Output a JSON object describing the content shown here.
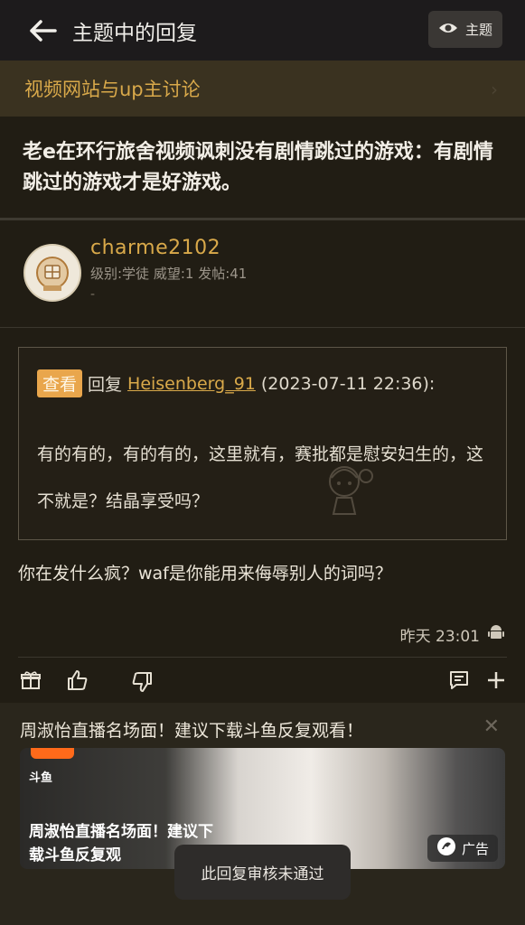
{
  "header": {
    "title": "主题中的回复",
    "topic_button_label": "主题"
  },
  "forum": {
    "name": "视频网站与up主讨论"
  },
  "post": {
    "title": "老e在环行旅舍视频讽刺没有剧情跳过的游戏：有剧情跳过的游戏才是好游戏。"
  },
  "author": {
    "name": "charme2102",
    "meta": "级别:学徒 威望:1 发帖:41",
    "sub": "-"
  },
  "quote": {
    "tag": "查看",
    "prefix": "回复",
    "user": "Heisenberg_91",
    "datetime": "(2023-07-11 22:36):",
    "body": "有的有的，有的有的，这里就有，赛批都是慰安妇生的，这不就是？结晶享受吗？"
  },
  "reply": {
    "text": "你在发什么疯？waf是你能用来侮辱别人的词吗？",
    "timestamp": "昨天 23:01"
  },
  "ad": {
    "title": "周淑怡直播名场面！建议下载斗鱼反复观看！",
    "brand": "斗鱼",
    "overlay_text": "周淑怡直播名场面！建议下载斗鱼反复观",
    "label": "广告"
  },
  "toast": {
    "text": "此回复审核未通过"
  },
  "colors": {
    "accent": "#d9a94a",
    "background": "#211d14",
    "tag": "#e9a64c"
  }
}
